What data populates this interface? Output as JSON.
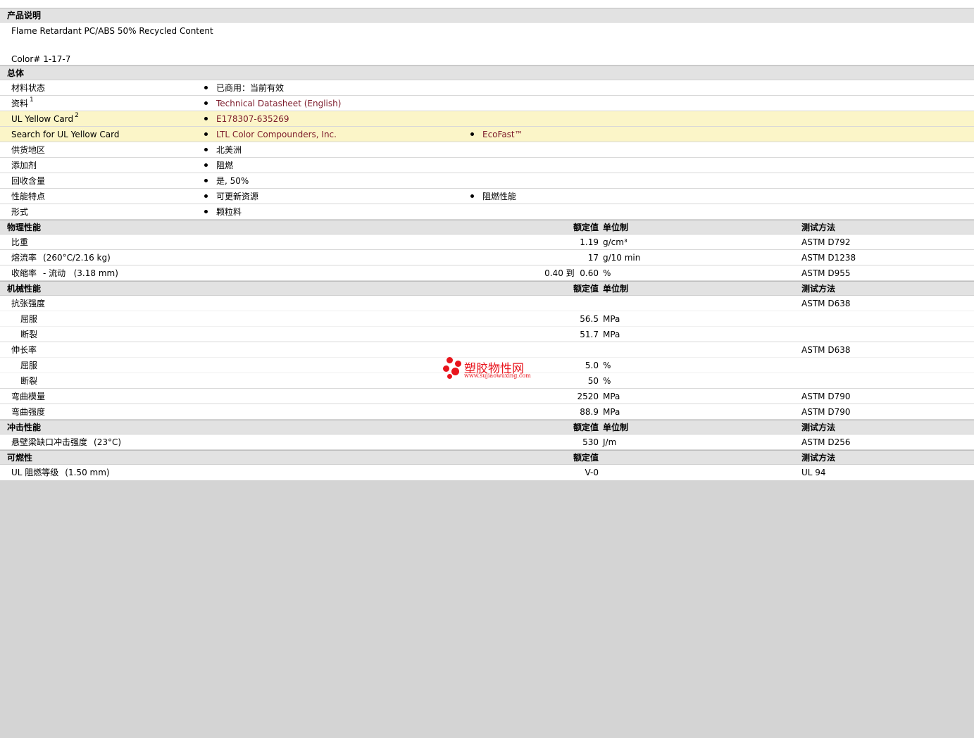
{
  "product_description": {
    "header": "产品说明",
    "line1": "Flame Retardant PC/ABS 50% Recycled Content",
    "line2": "Color# 1-17-7"
  },
  "general": {
    "header": "总体",
    "material_status": {
      "label": "材料状态",
      "value": "已商用：当前有效"
    },
    "documents": {
      "label": "资料",
      "sup": "1",
      "value": "Technical Datasheet (English)"
    },
    "ul_yellow_card": {
      "label": "UL Yellow Card",
      "sup": "2",
      "value": "E178307-635269"
    },
    "search_ul": {
      "label": "Search for UL Yellow Card",
      "value1": "LTL Color Compounders, Inc.",
      "value2": "EcoFast™"
    },
    "supply_region": {
      "label": "供货地区",
      "value": "北美洲"
    },
    "additive": {
      "label": "添加剂",
      "value": "阻燃"
    },
    "recycled": {
      "label": "回收含量",
      "value": "是, 50%"
    },
    "features": {
      "label": "性能特点",
      "value1": "可更新资源",
      "value2": "阻燃性能"
    },
    "form": {
      "label": "形式",
      "value": "颗粒料"
    }
  },
  "physical": {
    "header": "物理性能",
    "col_value": "额定值",
    "col_unit": "单位制",
    "col_method": "测试方法",
    "rows": [
      {
        "label": "比重",
        "value": "1.19",
        "unit": "g/cm³",
        "method": "ASTM D792"
      },
      {
        "label": "熔流率",
        "cond": "(260°C/2.16 kg)",
        "value": "17",
        "unit": "g/10 min",
        "method": "ASTM D1238"
      },
      {
        "label": "收缩率",
        "cond": "- 流动   (3.18 mm)",
        "value": "0.40 到  0.60",
        "unit": "%",
        "method": "ASTM D955"
      }
    ]
  },
  "mechanical": {
    "header": "机械性能",
    "col_value": "额定值",
    "col_unit": "单位制",
    "col_method": "测试方法",
    "tensile": {
      "label": "抗张强度",
      "method": "ASTM D638",
      "yield": {
        "label": "屈服",
        "value": "56.5",
        "unit": "MPa"
      },
      "break": {
        "label": "断裂",
        "value": "51.7",
        "unit": "MPa"
      }
    },
    "elongation": {
      "label": "伸长率",
      "method": "ASTM D638",
      "yield": {
        "label": "屈服",
        "value": "5.0",
        "unit": "%"
      },
      "break": {
        "label": "断裂",
        "value": "50",
        "unit": "%"
      }
    },
    "flex_modulus": {
      "label": "弯曲模量",
      "value": "2520",
      "unit": "MPa",
      "method": "ASTM D790"
    },
    "flex_strength": {
      "label": "弯曲强度",
      "value": "88.9",
      "unit": "MPa",
      "method": "ASTM D790"
    }
  },
  "impact": {
    "header": "冲击性能",
    "col_value": "额定值",
    "col_unit": "单位制",
    "col_method": "测试方法",
    "izod": {
      "label": "悬壁梁缺口冲击强度",
      "cond": "(23°C)",
      "value": "530",
      "unit": "J/m",
      "method": "ASTM D256"
    }
  },
  "flammability": {
    "header": "可燃性",
    "col_value": "额定值",
    "col_method": "测试方法",
    "ul": {
      "label": "UL 阻燃等级",
      "cond": "(1.50 mm)",
      "value": "V-0",
      "method": "UL 94"
    }
  },
  "watermark": {
    "title": "塑胶物性网",
    "url": "www.sujiaowuxing.com",
    "color": "#e8141c"
  },
  "colors": {
    "link": "#7c1a2a",
    "highlight_row": "#fbf5c8",
    "section_header": "#e2e2e2",
    "page_background": "#d4d4d4"
  }
}
